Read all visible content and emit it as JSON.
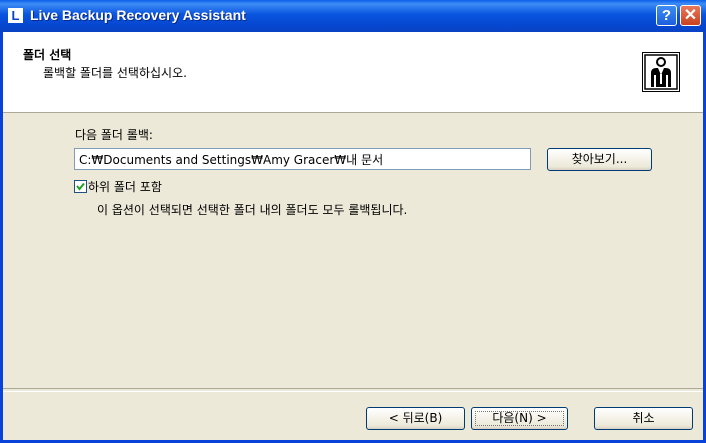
{
  "window": {
    "title": "Live Backup Recovery Assistant",
    "app_icon_letter": "L",
    "help_label": "?",
    "close_label": "✕"
  },
  "header": {
    "title": "폴더 선택",
    "subtitle": "롤백할 폴더를 선택하십시오."
  },
  "content": {
    "folder_label": "다음 폴더 롤백:",
    "folder_path": "C:₩Documents and Settings₩Amy Gracer₩내 문서",
    "browse_label": "찾아보기...",
    "include_subfolders_label": "하위 폴더 포함",
    "include_subfolders_checked": true,
    "include_subfolders_desc": "이 옵션이 선택되면 선택한 폴더 내의 폴더도 모두 롤백됩니다."
  },
  "footer": {
    "back_label": "< 뒤로(B)",
    "next_label": "다음(N) >",
    "cancel_label": "취소"
  },
  "colors": {
    "titlebar": "#0a55df",
    "dialog_bg": "#ece9d8",
    "close_button": "#c8421f"
  }
}
